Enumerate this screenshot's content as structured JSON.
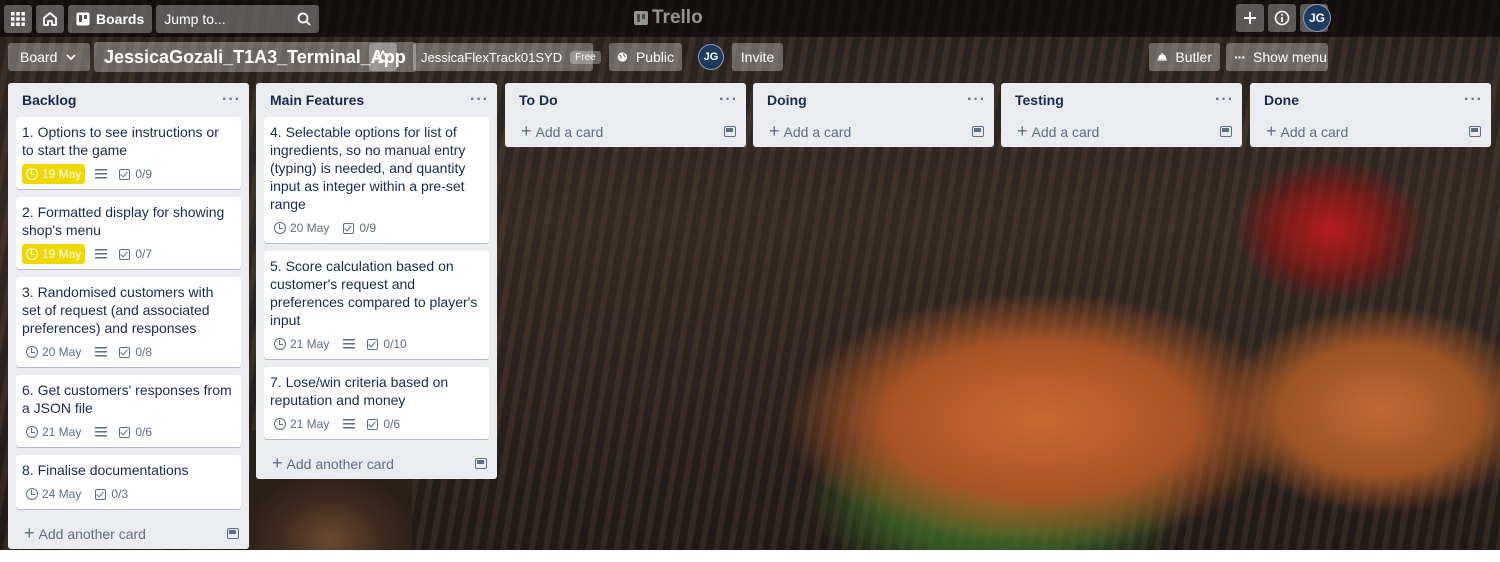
{
  "topbar": {
    "boards_label": "Boards",
    "search_placeholder": "Jump to...",
    "logo_text": "Trello",
    "user_initials": "JG"
  },
  "board": {
    "view_label": "Board",
    "title": "JessicaGozali_T1A3_Terminal_App",
    "team_name": "JessicaFlexTrack01SYD",
    "team_badge": "Free",
    "visibility": "Public",
    "member_initials": "JG",
    "invite_label": "Invite",
    "butler_label": "Butler",
    "show_menu_label": "Show menu"
  },
  "lists": [
    {
      "title": "Backlog",
      "cards": [
        {
          "title": "1. Options to see instructions or to start the game",
          "due": "19 May",
          "due_color": "#f2d600",
          "description": true,
          "checklist": "0/9"
        },
        {
          "title": "2. Formatted display for showing shop's menu",
          "due": "19 May",
          "due_color": "#f2d600",
          "description": true,
          "checklist": "0/7"
        },
        {
          "title": "3. Randomised customers with set of request (and associated preferences) and responses",
          "due": "20 May",
          "description": true,
          "checklist": "0/8"
        },
        {
          "title": "6. Get customers' responses from a JSON file",
          "due": "21 May",
          "description": true,
          "checklist": "0/6"
        },
        {
          "title": "8. Finalise documentations",
          "due": "24 May",
          "description": false,
          "checklist": "0/3"
        }
      ],
      "add_label": "Add another card"
    },
    {
      "title": "Main Features",
      "cards": [
        {
          "title": "4. Selectable options for list of ingredients, so no manual entry (typing) is needed, and quantity input as integer within a pre-set range",
          "due": "20 May",
          "description": false,
          "checklist": "0/9"
        },
        {
          "title": "5. Score calculation based on customer's request and preferences compared to player's input",
          "due": "21 May",
          "description": true,
          "checklist": "0/10"
        },
        {
          "title": "7. Lose/win criteria based on reputation and money",
          "due": "21 May",
          "description": true,
          "checklist": "0/6"
        }
      ],
      "add_label": "Add another card"
    },
    {
      "title": "To Do",
      "cards": [],
      "add_label": "Add a card"
    },
    {
      "title": "Doing",
      "cards": [],
      "add_label": "Add a card"
    },
    {
      "title": "Testing",
      "cards": [],
      "add_label": "Add a card"
    },
    {
      "title": "Done",
      "cards": [],
      "add_label": "Add a card"
    }
  ],
  "icons": {
    "apps": "apps-grid-icon",
    "home": "home-icon",
    "boards": "boards-icon",
    "search": "search-icon",
    "create": "plus-icon",
    "info": "info-icon",
    "notifications": "bell-icon",
    "star": "star-icon",
    "public": "globe-icon",
    "butler": "butler-icon",
    "menu": "ellipsis-icon"
  }
}
